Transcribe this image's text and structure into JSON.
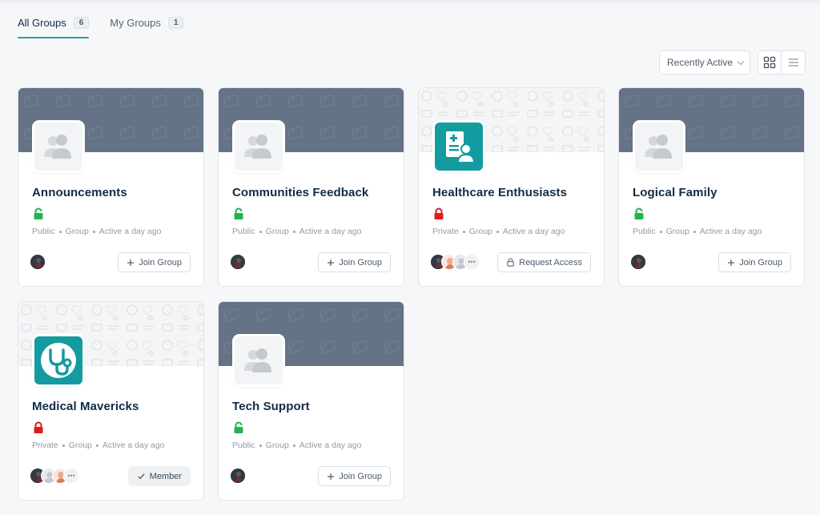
{
  "tabs": [
    {
      "label": "All Groups",
      "count": "6",
      "active": true
    },
    {
      "label": "My Groups",
      "count": "1",
      "active": false
    }
  ],
  "toolbar": {
    "sort_label": "Recently Active",
    "grid_view_icon": "grid-icon",
    "list_view_icon": "list-icon"
  },
  "colors": {
    "accent": "#2f9aa4",
    "cover": "#647385",
    "public_lock": "#21b34f",
    "private_lock": "#e01b1b",
    "teal_avatar": "#139ba0"
  },
  "groups": [
    {
      "name": "Announcements",
      "privacy": "Public",
      "type": "Group",
      "activity": "Active a day ago",
      "action": "Join Group",
      "cover": "default",
      "avatar": "group-placeholder-icon"
    },
    {
      "name": "Communities Feedback",
      "privacy": "Public",
      "type": "Group",
      "activity": "Active a day ago",
      "action": "Join Group",
      "cover": "default",
      "avatar": "group-placeholder-icon"
    },
    {
      "name": "Healthcare Enthusiasts",
      "privacy": "Private",
      "type": "Group",
      "activity": "Active a day ago",
      "action": "Request Access",
      "cover": "pattern",
      "avatar": "medical-record-icon"
    },
    {
      "name": "Logical Family",
      "privacy": "Public",
      "type": "Group",
      "activity": "Active a day ago",
      "action": "Join Group",
      "cover": "default",
      "avatar": "group-placeholder-icon"
    },
    {
      "name": "Medical Mavericks",
      "privacy": "Private",
      "type": "Group",
      "activity": "Active a day ago",
      "action": "Member",
      "cover": "pattern",
      "avatar": "stethoscope-icon"
    },
    {
      "name": "Tech Support",
      "privacy": "Public",
      "type": "Group",
      "activity": "Active a day ago",
      "action": "Join Group",
      "cover": "default",
      "avatar": "group-placeholder-icon"
    }
  ]
}
